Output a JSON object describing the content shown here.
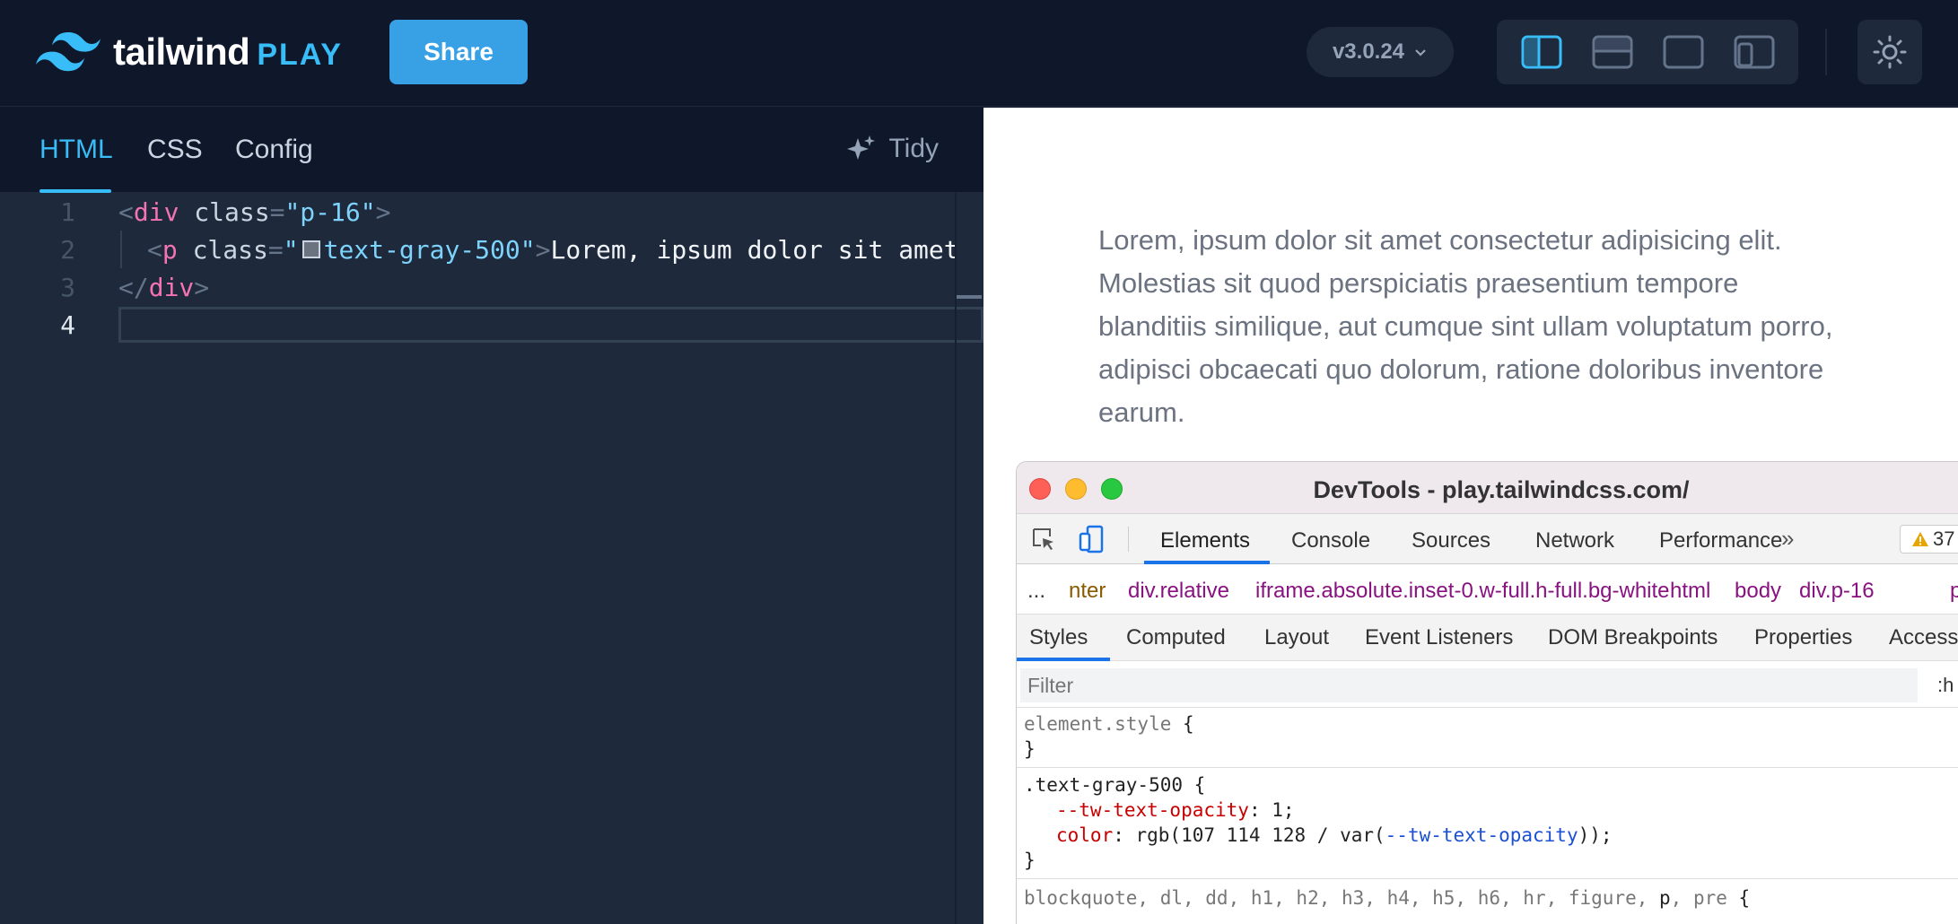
{
  "header": {
    "logo_text": "tailwind",
    "logo_play": "PLAY",
    "share_label": "Share",
    "version": "v3.0.24"
  },
  "editor": {
    "tabs": [
      "HTML",
      "CSS",
      "Config"
    ],
    "active_tab": "HTML",
    "tidy_label": "Tidy",
    "line_numbers": [
      "1",
      "2",
      "3",
      "4"
    ],
    "lines": {
      "l1_open": "<",
      "l1_tag": "div",
      "l1_attr": " class",
      "l1_eq": "=",
      "l1_str": "\"p-16\"",
      "l1_close": ">",
      "l2_open": "<",
      "l2_tag": "p",
      "l2_attr": " class",
      "l2_eq": "=",
      "l2_q1": "\"",
      "l2_str": "text-gray-500",
      "l2_q2": "\"",
      "l2_close": ">",
      "l2_text": "Lorem, ipsum dolor sit amet",
      "l3_open": "</",
      "l3_tag": "div",
      "l3_close": ">"
    },
    "swatch_color": "#6b7280"
  },
  "preview": {
    "paragraph": "Lorem, ipsum dolor sit amet consectetur adipisicing elit. Molestias sit quod perspiciatis praesentium tempore blanditiis similique, aut cumque sint ullam voluptatum porro, adipisci obcaecati quo dolorum, ratione doloribus inventore earum."
  },
  "devtools": {
    "title": "DevTools - play.tailwindcss.com/",
    "tabs": [
      "Elements",
      "Console",
      "Sources",
      "Network",
      "Performance"
    ],
    "more": "»",
    "warning_count": "37",
    "breadcrumbs": [
      "...",
      "nter",
      "div.relative",
      "iframe.absolute.inset-0.w-full.h-full.bg-white",
      "html",
      "body",
      "div.p-16",
      "p"
    ],
    "subtabs": [
      "Styles",
      "Computed",
      "Layout",
      "Event Listeners",
      "DOM Breakpoints",
      "Properties",
      "Access"
    ],
    "filter_placeholder": "Filter",
    "filter_right": ":h",
    "rules": {
      "r1_sel": "element.style",
      "r1_open": " {",
      "r1_close": "}",
      "r2_sel": ".text-gray-500",
      "r2_open": " {",
      "r2_p1_name": "--tw-text-opacity",
      "r2_p1_val": ": 1;",
      "r2_p2_name": "color",
      "r2_p2_val1": ": rgb(107 114 128 / var(",
      "r2_p2_var": "--tw-text-opacity",
      "r2_p2_val2": "));",
      "r2_close": "}",
      "r3_sel_grey": "blockquote, dl, dd, h1, h2, h3, h4, h5, h6, hr, figure, ",
      "r3_sel_p": "p",
      "r3_sel_mid": ", pre",
      "r3_open": " {"
    }
  },
  "colors": {
    "accent": "#38bdf8",
    "share": "#38a1e6",
    "bg_dark": "#0f172a",
    "editor_bg": "#1e293b"
  }
}
